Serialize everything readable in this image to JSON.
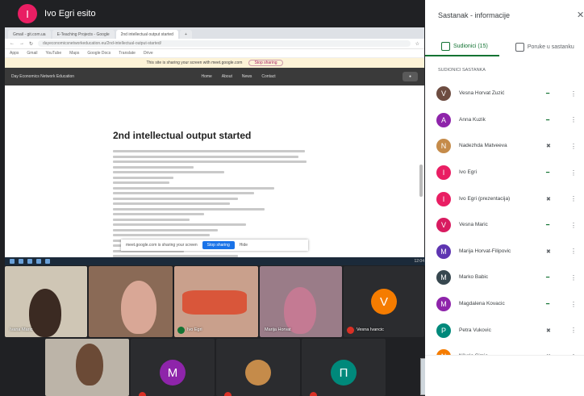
{
  "presenter": {
    "initial": "I",
    "name": "Ivo Egri esito"
  },
  "browser": {
    "tabs": [
      "Gmail - git.com.ua",
      "E-Teaching Projects - Google",
      "2nd intellectual output started",
      "+"
    ],
    "url": "dayeconomicsnetworkeducation.eu/2nd-intellectual-output-started/",
    "bookmarks": [
      "Apps",
      "Gmail",
      "YouTube",
      "Maps",
      "Google Docs",
      "Translate",
      "Drive"
    ],
    "info_text": "This site is sharing your screen with meet.google.com",
    "info_button": "Stop sharing",
    "site_nav": [
      "Home",
      "About",
      "News",
      "Contact"
    ],
    "site_brand": "Day Economics Network Education"
  },
  "article": {
    "title": "2nd intellectual output started"
  },
  "sharebar": {
    "text": "meet.google.com is sharing your screen",
    "stop": "Stop sharing",
    "hide": "Hide"
  },
  "taskbar": {
    "time": "12:04"
  },
  "tiles": [
    {
      "name": "Ivana Maric"
    },
    {
      "name": ""
    },
    {
      "name": "Ivo Egri"
    },
    {
      "name": "Marija Horvat"
    },
    {
      "name": "Vesna Ivancic",
      "initial": "V"
    },
    {
      "name": ""
    },
    {
      "initial": "M"
    },
    {
      "initial": ""
    },
    {
      "initial": "П"
    }
  ],
  "panel": {
    "title": "Sastanak - informacije",
    "tab_people": "Sudionici (15)",
    "tab_chat": "Poruke u sastanku",
    "section": "SUDIONICI SASTANKA",
    "participants": [
      {
        "name": "Vesna Horvat Zuzić",
        "color": "#6d4c41",
        "initial": "V",
        "mic": "active"
      },
      {
        "name": "Anna Kuzik",
        "color": "#8e24aa",
        "initial": "A",
        "mic": "active"
      },
      {
        "name": "Nadezhda Matveeva",
        "color": "#c58b4a",
        "initial": "N",
        "mic": "muted"
      },
      {
        "name": "Ivo Egri",
        "color": "#e91e63",
        "initial": "I",
        "mic": "active"
      },
      {
        "name": "Ivo Egri (prezentacija)",
        "color": "#e91e63",
        "initial": "I",
        "mic": "muted"
      },
      {
        "name": "Vesna Maric",
        "color": "#d81b60",
        "initial": "V",
        "mic": "active"
      },
      {
        "name": "Marija Horvat-Filipovic",
        "color": "#5e35b1",
        "initial": "M",
        "mic": "muted"
      },
      {
        "name": "Marko Babic",
        "color": "#37474f",
        "initial": "M",
        "mic": "active"
      },
      {
        "name": "Magdalena Kovacic",
        "color": "#8e24aa",
        "initial": "M",
        "mic": "active"
      },
      {
        "name": "Petra Vukovic",
        "color": "#00897b",
        "initial": "P",
        "mic": "muted"
      },
      {
        "name": "Nikola Simic",
        "color": "#f57c00",
        "initial": "N",
        "mic": "muted"
      }
    ]
  }
}
